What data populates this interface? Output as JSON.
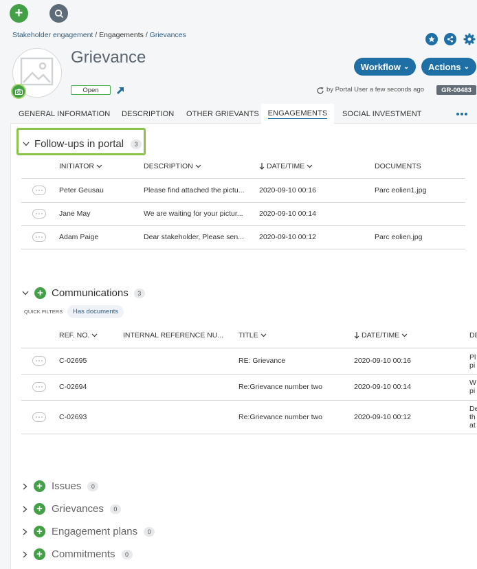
{
  "breadcrumb": [
    {
      "label": "Stakeholder engagement"
    },
    {
      "label": "Engagements"
    },
    {
      "label": "Grievances"
    }
  ],
  "record": {
    "title": "Grievance",
    "status": "Open",
    "modified": "by Portal User a few seconds ago",
    "id": "GR-00483"
  },
  "buttons": {
    "workflow": "Workflow",
    "actions": "Actions"
  },
  "tabs": [
    {
      "label": "GENERAL INFORMATION"
    },
    {
      "label": "DESCRIPTION"
    },
    {
      "label": "OTHER GRIEVANTS"
    },
    {
      "label": "ENGAGEMENTS"
    },
    {
      "label": "SOCIAL INVESTMENT"
    }
  ],
  "tabs_active": "ENGAGEMENTS",
  "followups": {
    "title": "Follow-ups in portal",
    "count": "3",
    "columns": {
      "initiator": "INITIATOR",
      "description": "DESCRIPTION",
      "datetime": "DATE/TIME",
      "documents": "DOCUMENTS"
    },
    "rows": [
      {
        "initiator": "Peter Geusau",
        "description": "Please find attached the pictu...",
        "datetime": "2020-09-10 00:16",
        "documents": "Parc eolien1.jpg"
      },
      {
        "initiator": "Jane May",
        "description": "We are waiting for your pictur...",
        "datetime": "2020-09-10 00:14",
        "documents": ""
      },
      {
        "initiator": "Adam Paige",
        "description": "Dear stakeholder, Please sen...",
        "datetime": "2020-09-10 00:12",
        "documents": "Parc eolien.jpg"
      }
    ]
  },
  "communications": {
    "title": "Communications",
    "count": "3",
    "quick_filters_label": "QUICK FILTERS",
    "filter": "Has documents",
    "columns": {
      "ref": "REF. NO.",
      "internal": "INTERNAL REFERENCE NU...",
      "title": "TITLE",
      "datetime": "DATE/TIME",
      "extra": "DE"
    },
    "rows": [
      {
        "ref": "C-02695",
        "title": "RE: Grievance",
        "datetime": "2020-09-10 00:16",
        "extra": [
          "Pl",
          "pi"
        ]
      },
      {
        "ref": "C-02694",
        "title": "Re:Grievance number two",
        "datetime": "2020-09-10 00:14",
        "extra": [
          "W",
          "pi"
        ]
      },
      {
        "ref": "C-02693",
        "title": "Re:Grievance number two",
        "datetime": "2020-09-10 00:12",
        "extra": [
          "De",
          "th",
          "at"
        ]
      }
    ]
  },
  "collapsed_sections": [
    {
      "title": "Issues",
      "count": "0"
    },
    {
      "title": "Grievances",
      "count": "0"
    },
    {
      "title": "Engagement plans",
      "count": "0"
    },
    {
      "title": "Commitments",
      "count": "0"
    }
  ],
  "colors": {
    "primary": "#1d6fa5",
    "green": "#43a047",
    "highlight": "#8bc34a"
  }
}
